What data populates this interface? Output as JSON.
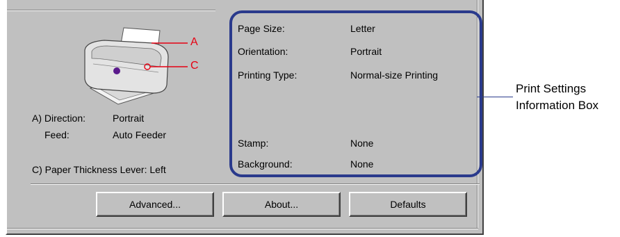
{
  "printer_panel": {
    "callout_a": "A",
    "callout_c": "C",
    "direction_label": "A) Direction:",
    "direction_value": "Portrait",
    "feed_label": "Feed:",
    "feed_value": "Auto Feeder",
    "paper_thickness": "C) Paper Thickness Lever:  Left"
  },
  "settings_info": {
    "rows": [
      {
        "label": "Page Size:",
        "value": "Letter"
      },
      {
        "label": "Orientation:",
        "value": "Portrait"
      },
      {
        "label": "Printing Type:",
        "value": "Normal-size Printing"
      },
      {
        "label": "Stamp:",
        "value": "None"
      },
      {
        "label": "Background:",
        "value": "None"
      }
    ]
  },
  "buttons": {
    "advanced": "Advanced...",
    "about": "About...",
    "defaults": "Defaults"
  },
  "annotation": {
    "line1": "Print Settings",
    "line2": "Information Box"
  },
  "colors": {
    "dialog_face": "#c0c0c0",
    "callout_red": "#e60012",
    "box_outline": "#2a3a8c"
  }
}
